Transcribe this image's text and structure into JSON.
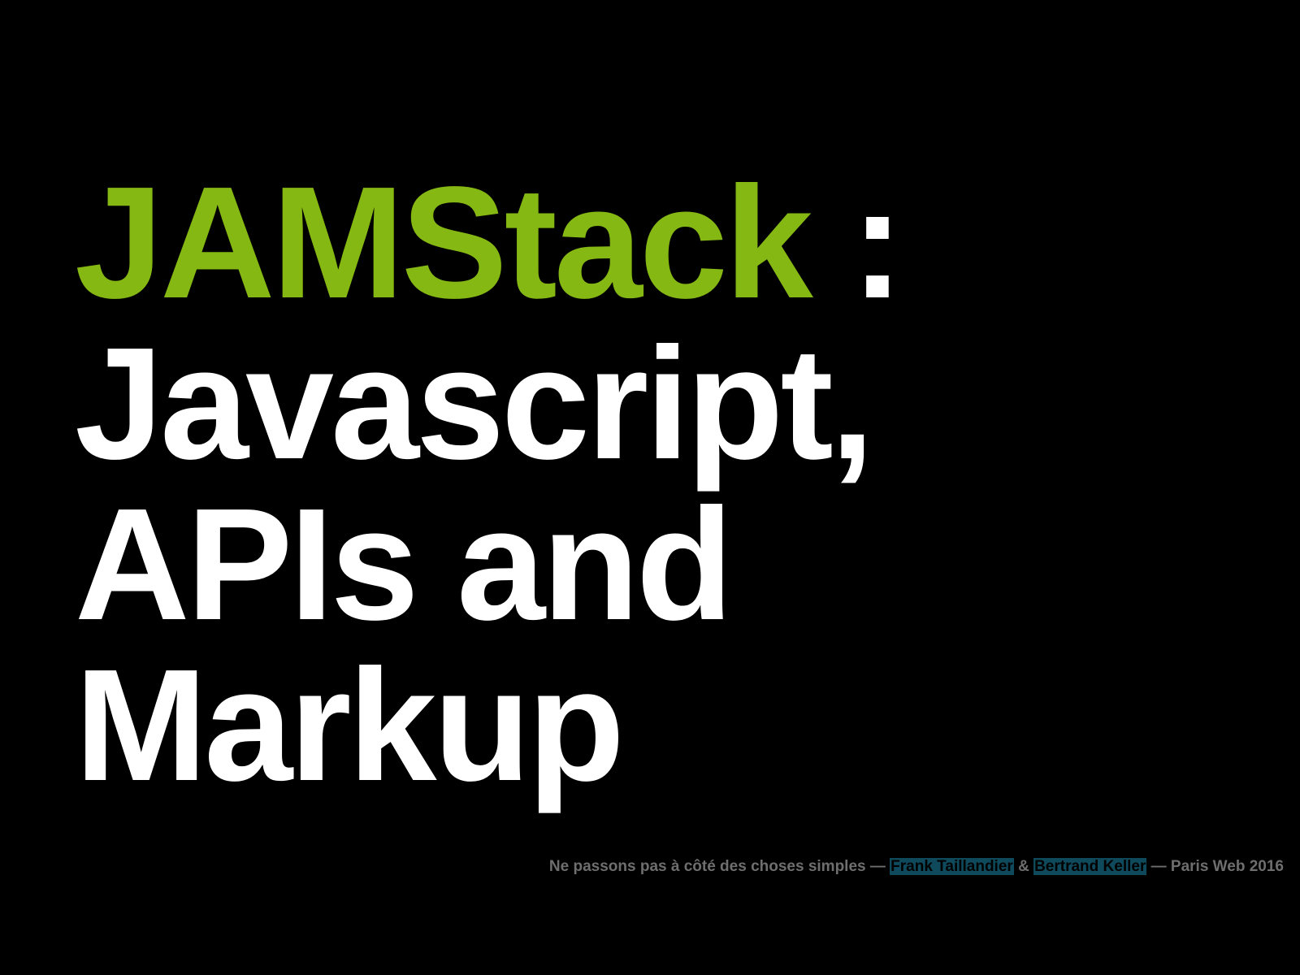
{
  "slide": {
    "title_accent": "JAMStack",
    "title_colon": " :",
    "title_line2": "Javascript,",
    "title_line3": "APIs and",
    "title_line4": "Markup"
  },
  "footer": {
    "talk_title": "Ne passons pas à côté des choses simples",
    "dash1": " — ",
    "author1": "Frank Taillandier",
    "amp": " & ",
    "author2": "Bertrand Keller",
    "dash2": " — ",
    "event": "Paris Web 2016"
  },
  "colors": {
    "background": "#000000",
    "accent": "#86b814",
    "text": "#ffffff",
    "footer_text": "#6e6e6e",
    "author_highlight": "#0f4a5c"
  }
}
